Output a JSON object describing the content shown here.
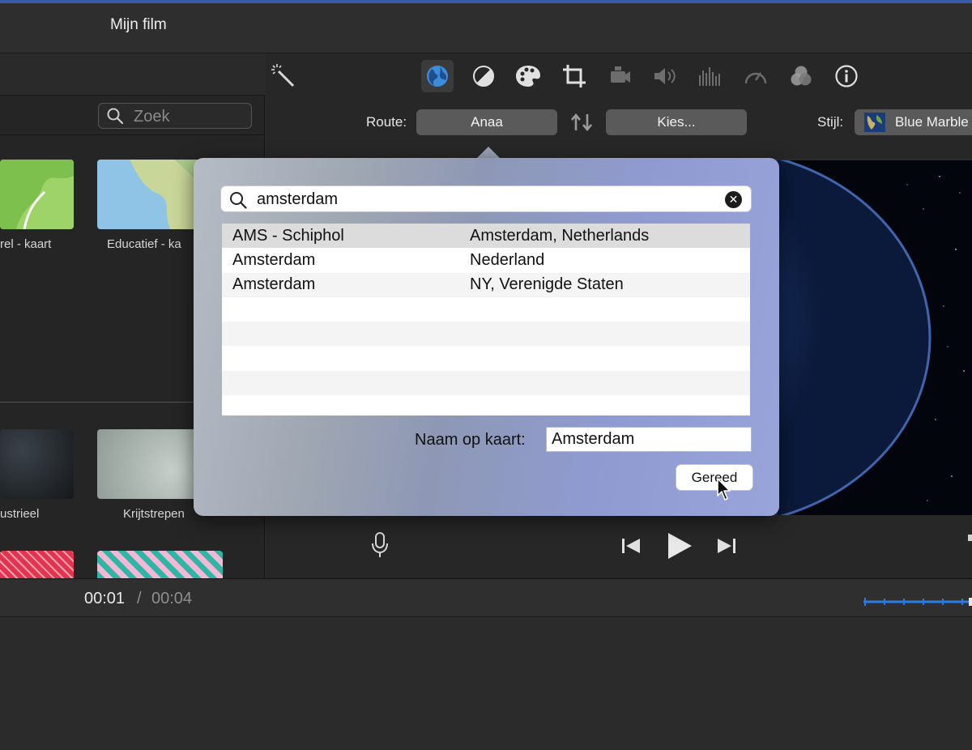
{
  "window": {
    "title": "Mijn film"
  },
  "browser": {
    "search_placeholder": "Zoek",
    "thumbnails": [
      {
        "label": "rel - kaart"
      },
      {
        "label": "Educatief - ka"
      },
      {
        "label": "ustrieel"
      },
      {
        "label": "Krijtstrepen"
      }
    ]
  },
  "toolbar": {
    "tools": [
      {
        "icon": "magic-wand-icon"
      },
      {
        "icon": "globe-icon",
        "active": true
      },
      {
        "icon": "color-balance-icon"
      },
      {
        "icon": "palette-icon"
      },
      {
        "icon": "crop-icon"
      },
      {
        "icon": "camera-icon"
      },
      {
        "icon": "speaker-icon"
      },
      {
        "icon": "equalizer-icon"
      },
      {
        "icon": "speedometer-icon"
      },
      {
        "icon": "filter-icon"
      },
      {
        "icon": "info-icon"
      }
    ],
    "route_label": "Route:",
    "route_start": "Anaa",
    "route_end": "Kies...",
    "style_label": "Stijl:",
    "style_value": "Blue Marble"
  },
  "popover": {
    "search_value": "amsterdam",
    "results": [
      {
        "name": "AMS - Schiphol",
        "location": "Amsterdam, Netherlands",
        "selected": true
      },
      {
        "name": "Amsterdam",
        "location": "Nederland"
      },
      {
        "name": "Amsterdam",
        "location": "NY, Verenigde Staten"
      },
      {
        "name": "",
        "location": ""
      },
      {
        "name": "",
        "location": ""
      },
      {
        "name": "",
        "location": ""
      },
      {
        "name": "",
        "location": ""
      },
      {
        "name": "",
        "location": ""
      }
    ],
    "name_label": "Naam op kaart:",
    "name_value": "Amsterdam",
    "done_label": "Gereed"
  },
  "timecode": {
    "current": "00:01",
    "separator": "/",
    "total": "00:04"
  },
  "colors": {
    "accent": "#2a7be4",
    "panel": "#252525"
  }
}
